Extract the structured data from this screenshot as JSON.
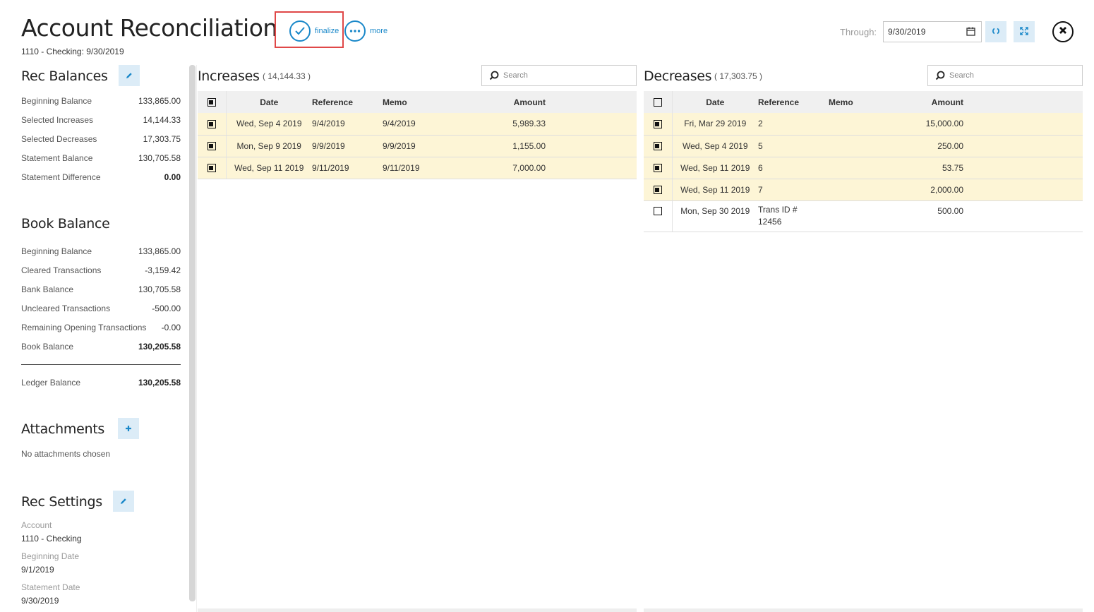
{
  "header": {
    "title": "Account Reconciliation",
    "subtitle": "1110 - Checking: 9/30/2019",
    "finalize_label": "finalize",
    "more_label": "more",
    "through_label": "Through:",
    "through_value": "9/30/2019"
  },
  "rec_balances": {
    "title": "Rec Balances",
    "rows": [
      {
        "label": "Beginning Balance",
        "value": "133,865.00"
      },
      {
        "label": "Selected Increases",
        "value": "14,144.33"
      },
      {
        "label": "Selected Decreases",
        "value": "17,303.75"
      },
      {
        "label": "Statement Balance",
        "value": "130,705.58"
      },
      {
        "label": "Statement Difference",
        "value": "0.00"
      }
    ]
  },
  "book_balance": {
    "title": "Book Balance",
    "rows": [
      {
        "label": "Beginning Balance",
        "value": "133,865.00"
      },
      {
        "label": "Cleared Transactions",
        "value": "-3,159.42"
      },
      {
        "label": "Bank Balance",
        "value": "130,705.58"
      },
      {
        "label": "Uncleared Transactions",
        "value": "-500.00"
      },
      {
        "label": "Remaining Opening Transactions",
        "value": "-0.00"
      },
      {
        "label": "Book Balance",
        "value": "130,205.58"
      }
    ],
    "ledger": {
      "label": "Ledger Balance",
      "value": "130,205.58"
    }
  },
  "attachments": {
    "title": "Attachments",
    "empty_text": "No attachments chosen"
  },
  "rec_settings": {
    "title": "Rec Settings",
    "account_label": "Account",
    "account_value": "1110 - Checking",
    "beginning_date_label": "Beginning Date",
    "beginning_date_value": "9/1/2019",
    "statement_date_label": "Statement Date",
    "statement_date_value": "9/30/2019"
  },
  "increases": {
    "title": "Increases",
    "total": "( 14,144.33 )",
    "search_placeholder": "Search",
    "columns": [
      "Date",
      "Reference",
      "Memo",
      "Amount"
    ],
    "rows": [
      {
        "date": "Wed, Sep 4 2019",
        "reference": "9/4/2019",
        "memo": "9/4/2019",
        "amount": "5,989.33",
        "selected": true
      },
      {
        "date": "Mon, Sep 9 2019",
        "reference": "9/9/2019",
        "memo": "9/9/2019",
        "amount": "1,155.00",
        "selected": true
      },
      {
        "date": "Wed, Sep 11 2019",
        "reference": "9/11/2019",
        "memo": "9/11/2019",
        "amount": "7,000.00",
        "selected": true
      }
    ]
  },
  "decreases": {
    "title": "Decreases",
    "total": "( 17,303.75 )",
    "search_placeholder": "Search",
    "columns": [
      "Date",
      "Reference",
      "Memo",
      "Amount"
    ],
    "rows": [
      {
        "date": "Fri, Mar 29 2019",
        "reference": "2",
        "memo": "",
        "amount": "15,000.00",
        "selected": true
      },
      {
        "date": "Wed, Sep 4 2019",
        "reference": "5",
        "memo": "",
        "amount": "250.00",
        "selected": true
      },
      {
        "date": "Wed, Sep 11 2019",
        "reference": "6",
        "memo": "",
        "amount": "53.75",
        "selected": true
      },
      {
        "date": "Wed, Sep 11 2019",
        "reference": "7",
        "memo": "",
        "amount": "2,000.00",
        "selected": true
      },
      {
        "date": "Mon, Sep 30 2019",
        "reference_line1": "Trans ID #",
        "reference_line2": "12456",
        "memo": "",
        "amount": "500.00",
        "selected": false
      }
    ]
  },
  "colors": {
    "accent": "#1a88c9",
    "selected_row": "#fdf5d6",
    "highlight": "#e04848"
  },
  "icons": [
    "check-icon",
    "ellipsis-icon",
    "calendar-icon",
    "refresh-icon",
    "expand-icon",
    "close-icon",
    "pencil-icon",
    "plus-icon",
    "search-icon"
  ]
}
